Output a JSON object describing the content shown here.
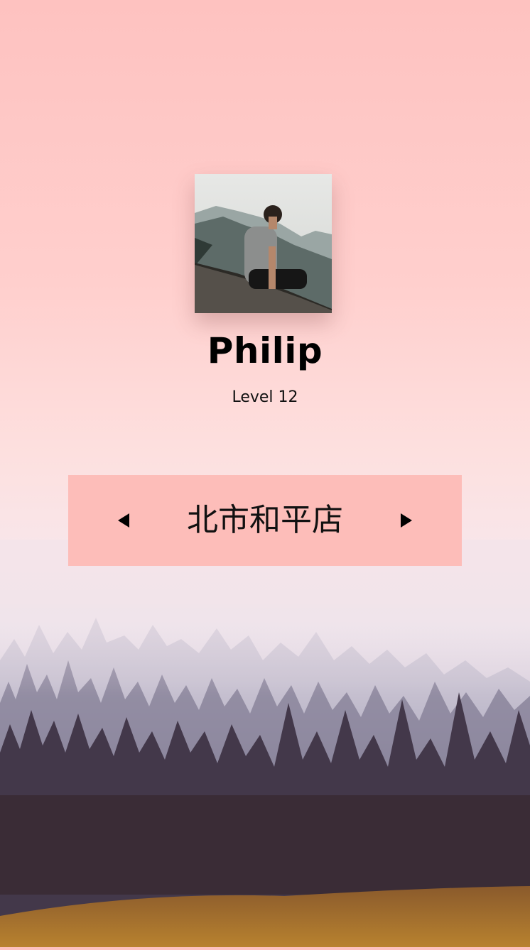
{
  "profile": {
    "name": "Philip",
    "level": "Level 12",
    "avatar_icon": "profile-photo"
  },
  "store_selector": {
    "current_store": "北市和平店",
    "prev_icon": "caret-left-icon",
    "next_icon": "caret-right-icon"
  },
  "colors": {
    "top_background": "#fec2c0",
    "selector_background": "#fdbdb9",
    "text": "#000000"
  }
}
